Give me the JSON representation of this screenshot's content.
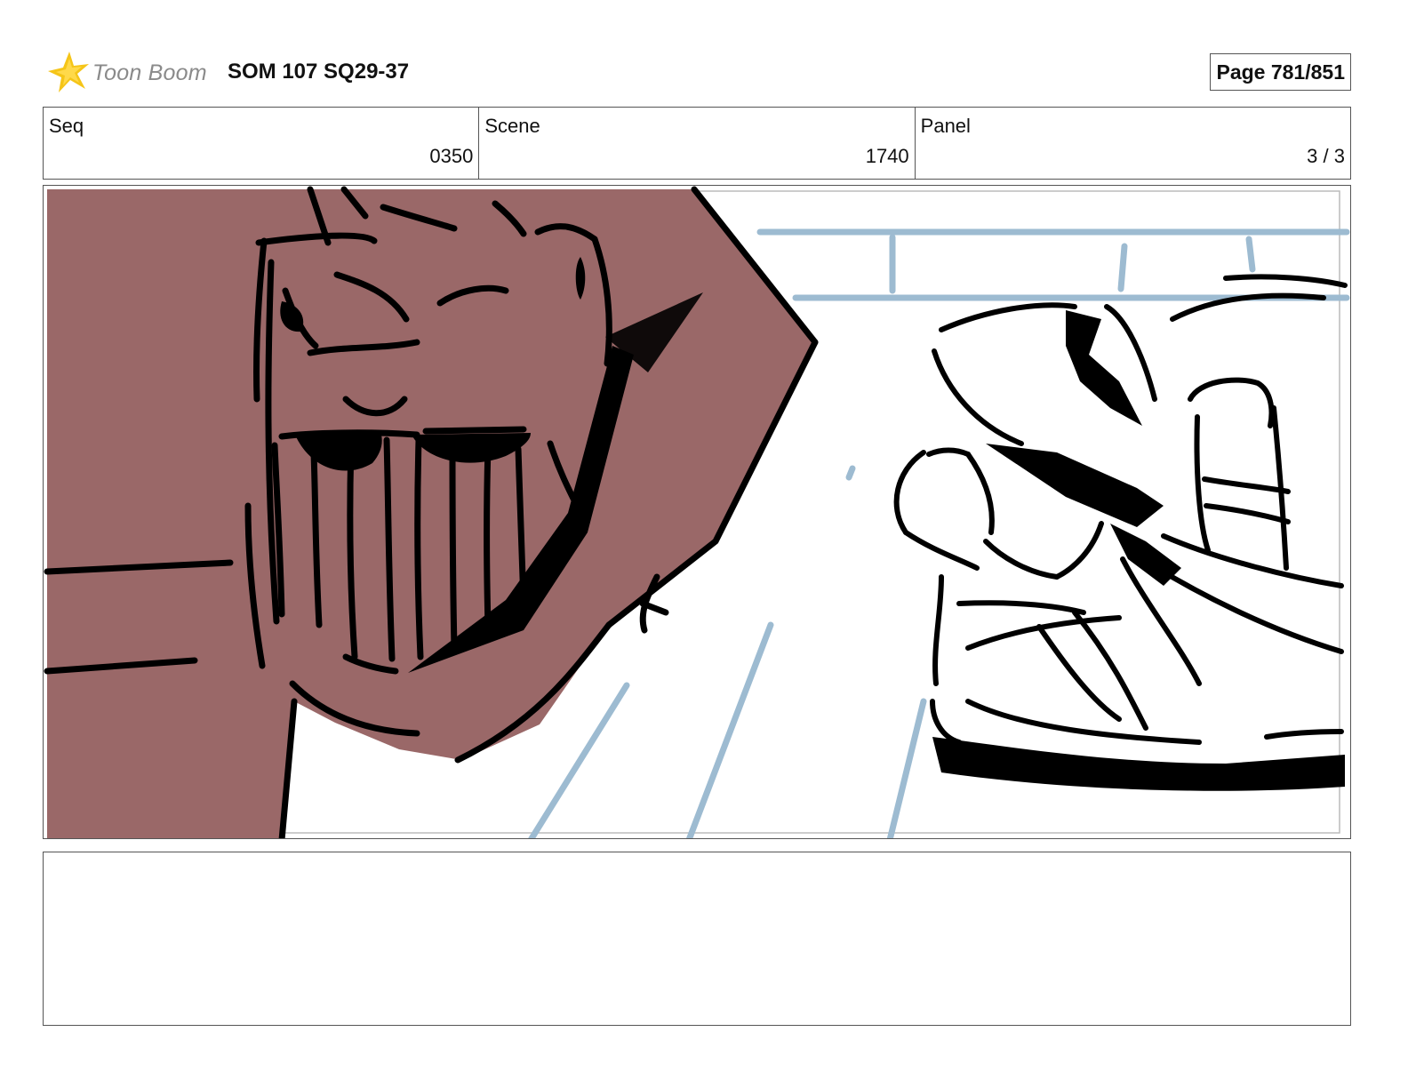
{
  "header": {
    "logo_text": "Toon Boom",
    "project_title": "SOM 107 SQ29-37",
    "page_label": "Page 781/851"
  },
  "info": {
    "seq_label": "Seq",
    "seq_value": "0350",
    "scene_label": "Scene",
    "scene_value": "1740",
    "panel_label": "Panel",
    "panel_value": "3 / 3"
  },
  "panel": {
    "image": "storyboard-sketch",
    "colors": {
      "creature_fill": "#9a6868",
      "guide_lines": "#9dbbd1",
      "ink": "#000000"
    }
  },
  "notes": {
    "text": ""
  },
  "colors": {
    "logo_star": "#f5c518",
    "logo_text": "#8a8a8a",
    "border": "#555555"
  }
}
